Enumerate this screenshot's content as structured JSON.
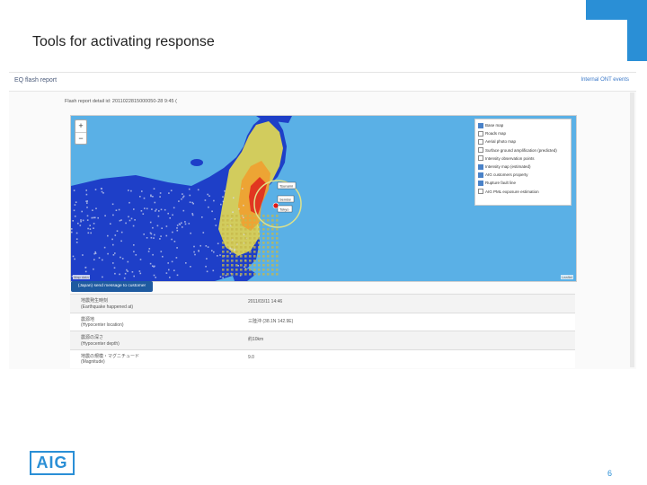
{
  "slide": {
    "title": "Tools for activating response",
    "page_number": "6",
    "logo_text": "AIG",
    "accent_color": "#2a8fd6"
  },
  "app": {
    "title": "EQ flash report",
    "top_link": "Internal ONT events",
    "report_id": "Flash report detail id: 2011022815000050-28 9:45 (",
    "action_button": "(Japan) send message to customer"
  },
  "map": {
    "zoom_in": "+",
    "zoom_out": "−",
    "attribution_left": "Map data",
    "attribution_right": "Leaflet",
    "callouts": [
      "Tsunami",
      "Sendai",
      "Tokyo"
    ],
    "colors": {
      "sea": "#5ab0e6",
      "land": "#1e3fc8",
      "intensity_low": "#f2e54a",
      "intensity_mid": "#f0a030",
      "intensity_high": "#e03020",
      "grid": "#c8b84a"
    },
    "legend": [
      {
        "label": "Base map",
        "checked": true
      },
      {
        "label": "Roads map",
        "checked": false
      },
      {
        "label": "Aerial photo map",
        "checked": false
      },
      {
        "label": "Surface ground amplification (predicted)",
        "checked": false
      },
      {
        "label": "Intensity observation points",
        "checked": false
      },
      {
        "label": "Intensity map (estimated)",
        "checked": true
      },
      {
        "label": "AIG customers property",
        "checked": true
      },
      {
        "label": "Rupture fault line",
        "checked": true
      },
      {
        "label": "AIG PML exposure estimation",
        "checked": false
      }
    ]
  },
  "details": [
    {
      "label_jp": "地震発生時刻",
      "label_en": "(Earthquake happened at)",
      "value": "2011/03/11 14:46"
    },
    {
      "label_jp": "震源地",
      "label_en": "(Hypocenter location)",
      "value": "三陸沖 (38.1N 142.9E)"
    },
    {
      "label_jp": "震源の深さ",
      "label_en": "(Hypocenter depth)",
      "value": "約10km"
    },
    {
      "label_jp": "地震の規模・マグニチュード",
      "label_en": "(Magnitude)",
      "value": "9.0"
    }
  ]
}
